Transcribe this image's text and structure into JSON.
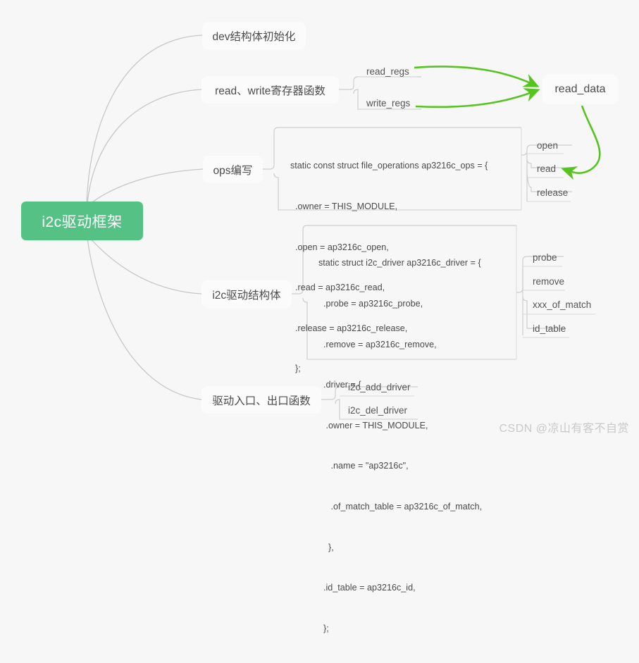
{
  "background_color": "#f7f7f7",
  "accent_color": "#55c184",
  "arrow_color": "#55c41f",
  "edge_color": "#c8c8c8",
  "root": {
    "label": "i2c驱动框架"
  },
  "branches": [
    {
      "id": "dev-init",
      "label": "dev结构体初始化"
    },
    {
      "id": "rw-regs",
      "label": "read、write寄存器函数"
    },
    {
      "id": "ops-write",
      "label": "ops编写"
    },
    {
      "id": "i2c-struct",
      "label": "i2c驱动结构体"
    },
    {
      "id": "entry-exit",
      "label": "驱动入口、出口函数"
    }
  ],
  "leaves": {
    "rw_regs": [
      {
        "id": "read-regs",
        "label": "read_regs"
      },
      {
        "id": "write-regs",
        "label": "write_regs"
      }
    ],
    "ops": [
      {
        "id": "open",
        "label": "open"
      },
      {
        "id": "read",
        "label": "read"
      },
      {
        "id": "release",
        "label": "release"
      }
    ],
    "driver": [
      {
        "id": "probe",
        "label": "probe"
      },
      {
        "id": "remove",
        "label": "remove"
      },
      {
        "id": "xxx-of-match",
        "label": "xxx_of_match"
      },
      {
        "id": "id-table",
        "label": "id_table"
      }
    ],
    "entry": [
      {
        "id": "i2c-add-driver",
        "label": "i2c_add_driver"
      },
      {
        "id": "i2c-del-driver",
        "label": "i2c_del_driver"
      }
    ]
  },
  "callout": {
    "read_data": "read_data"
  },
  "code_blocks": {
    "ops": {
      "lines": [
        "static const struct file_operations ap3216c_ops = {",
        "  .owner = THIS_MODULE,",
        "  .open = ap3216c_open,",
        "  .read = ap3216c_read,",
        "  .release = ap3216c_release,",
        "  };"
      ]
    },
    "driver": {
      "lines": [
        "static struct i2c_driver ap3216c_driver = {",
        "  .probe = ap3216c_probe,",
        "  .remove = ap3216c_remove,",
        "  .driver = {",
        "   .owner = THIS_MODULE,",
        "     .name = \"ap3216c\",",
        "     .of_match_table = ap3216c_of_match,",
        "    },",
        "  .id_table = ap3216c_id,",
        "  };"
      ]
    }
  },
  "watermark": {
    "text": "CSDN @凉山有客不自赏"
  }
}
